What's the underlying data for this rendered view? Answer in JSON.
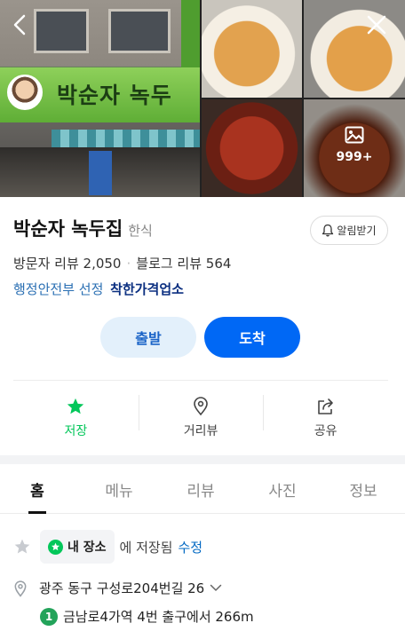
{
  "colors": {
    "accent_green": "#03c75a",
    "primary_blue": "#0068f5",
    "subway_line_1": "#23a35a"
  },
  "photos": {
    "more_count": "999+",
    "sign_text": "박순자 녹두"
  },
  "place": {
    "name": "박순자 녹두집",
    "category": "한식",
    "alarm_label": "알림받기",
    "visitor_reviews": "방문자 리뷰 2,050",
    "blog_reviews": "블로그 리뷰 564",
    "gov_label": "행정안전부 선정",
    "good_price_label": "착한가격업소"
  },
  "route": {
    "depart_label": "출발",
    "arrive_label": "도착"
  },
  "actions": [
    {
      "label": "저장",
      "icon": "star-icon"
    },
    {
      "label": "거리뷰",
      "icon": "map-pin-icon"
    },
    {
      "label": "공유",
      "icon": "share-icon"
    }
  ],
  "tabs": [
    "홈",
    "메뉴",
    "리뷰",
    "사진",
    "정보"
  ],
  "active_tab": "홈",
  "info": {
    "saved_chip": "내 장소",
    "saved_text": "에 저장됨",
    "edit_label": "수정",
    "address": "광주 동구 구성로204번길 26",
    "subway_line": "1",
    "subway_text": "금남로4가역 4번 출구에서 266m"
  }
}
